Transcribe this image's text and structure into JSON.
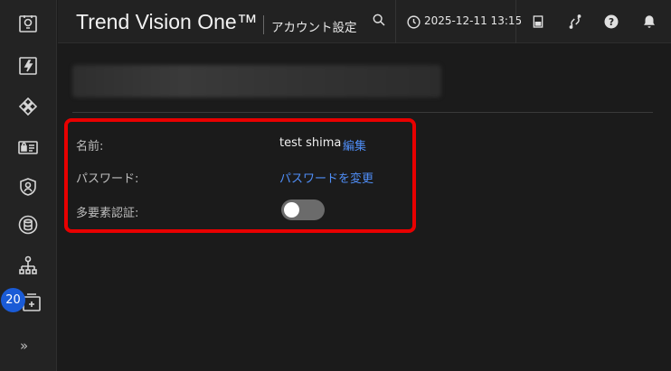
{
  "header": {
    "brand": "Trend Vision One™",
    "page_name": "アカウント設定",
    "datetime": "2025-12-11 13:15"
  },
  "sidebar": {
    "badge_count": "20",
    "expand_label": "»",
    "icons": [
      "dashboard-icon",
      "lightning-icon",
      "network-icon",
      "id-card-icon",
      "shield-user-icon",
      "database-globe-icon",
      "network-nodes-icon",
      "workflow-icon"
    ]
  },
  "account": {
    "name_label": "名前:",
    "name_value": "test shima",
    "edit_link": "編集",
    "password_label": "パスワード:",
    "password_link": "パスワードを変更",
    "mfa_label": "多要素認証:",
    "mfa_enabled": false
  },
  "colors": {
    "link": "#4f8ef7",
    "highlight_border": "#e80000",
    "badge": "#1a5bd6"
  }
}
